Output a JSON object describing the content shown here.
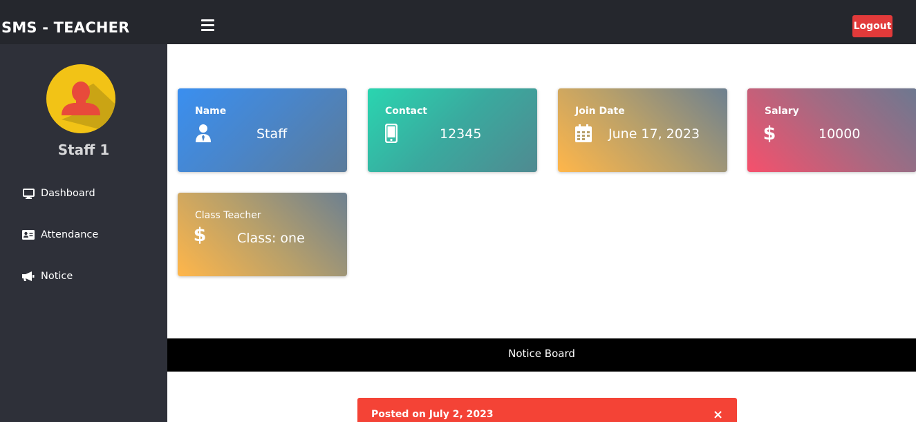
{
  "app": {
    "brand": "SMS - TEACHER"
  },
  "topbar": {
    "menu_icon": "hamburger-menu-icon",
    "logout_label": "Logout"
  },
  "sidebar": {
    "avatar_icon": "user-avatar-icon",
    "user_name": "Staff 1",
    "items": [
      {
        "label": "Dashboard",
        "icon": "monitor-icon"
      },
      {
        "label": "Attendance",
        "icon": "id-card-icon"
      },
      {
        "label": "Notice",
        "icon": "megaphone-icon"
      }
    ]
  },
  "cards": {
    "name": {
      "title": "Name",
      "value": "Staff",
      "icon": "user-tie-icon"
    },
    "contact": {
      "title": "Contact",
      "value": "12345",
      "icon": "mobile-phone-icon"
    },
    "join_date": {
      "title": "Join Date",
      "value": "June 17, 2023",
      "icon": "calendar-icon"
    },
    "salary": {
      "title": "Salary",
      "value": "10000",
      "icon": "dollar-icon"
    },
    "class_teacher": {
      "title": "Class Teacher",
      "value": "Class: one",
      "icon": "dollar-icon"
    }
  },
  "notice": {
    "board_title": "Notice Board",
    "posted_text": "Posted on July 2, 2023",
    "close_symbol": "×"
  },
  "colors": {
    "topbar": "#25272d",
    "sidebar": "#2e3039",
    "avatar_bg": "#f2c316",
    "avatar_figure": "#e84a3b",
    "logout": "#e23a3a",
    "alert": "#f44336"
  }
}
